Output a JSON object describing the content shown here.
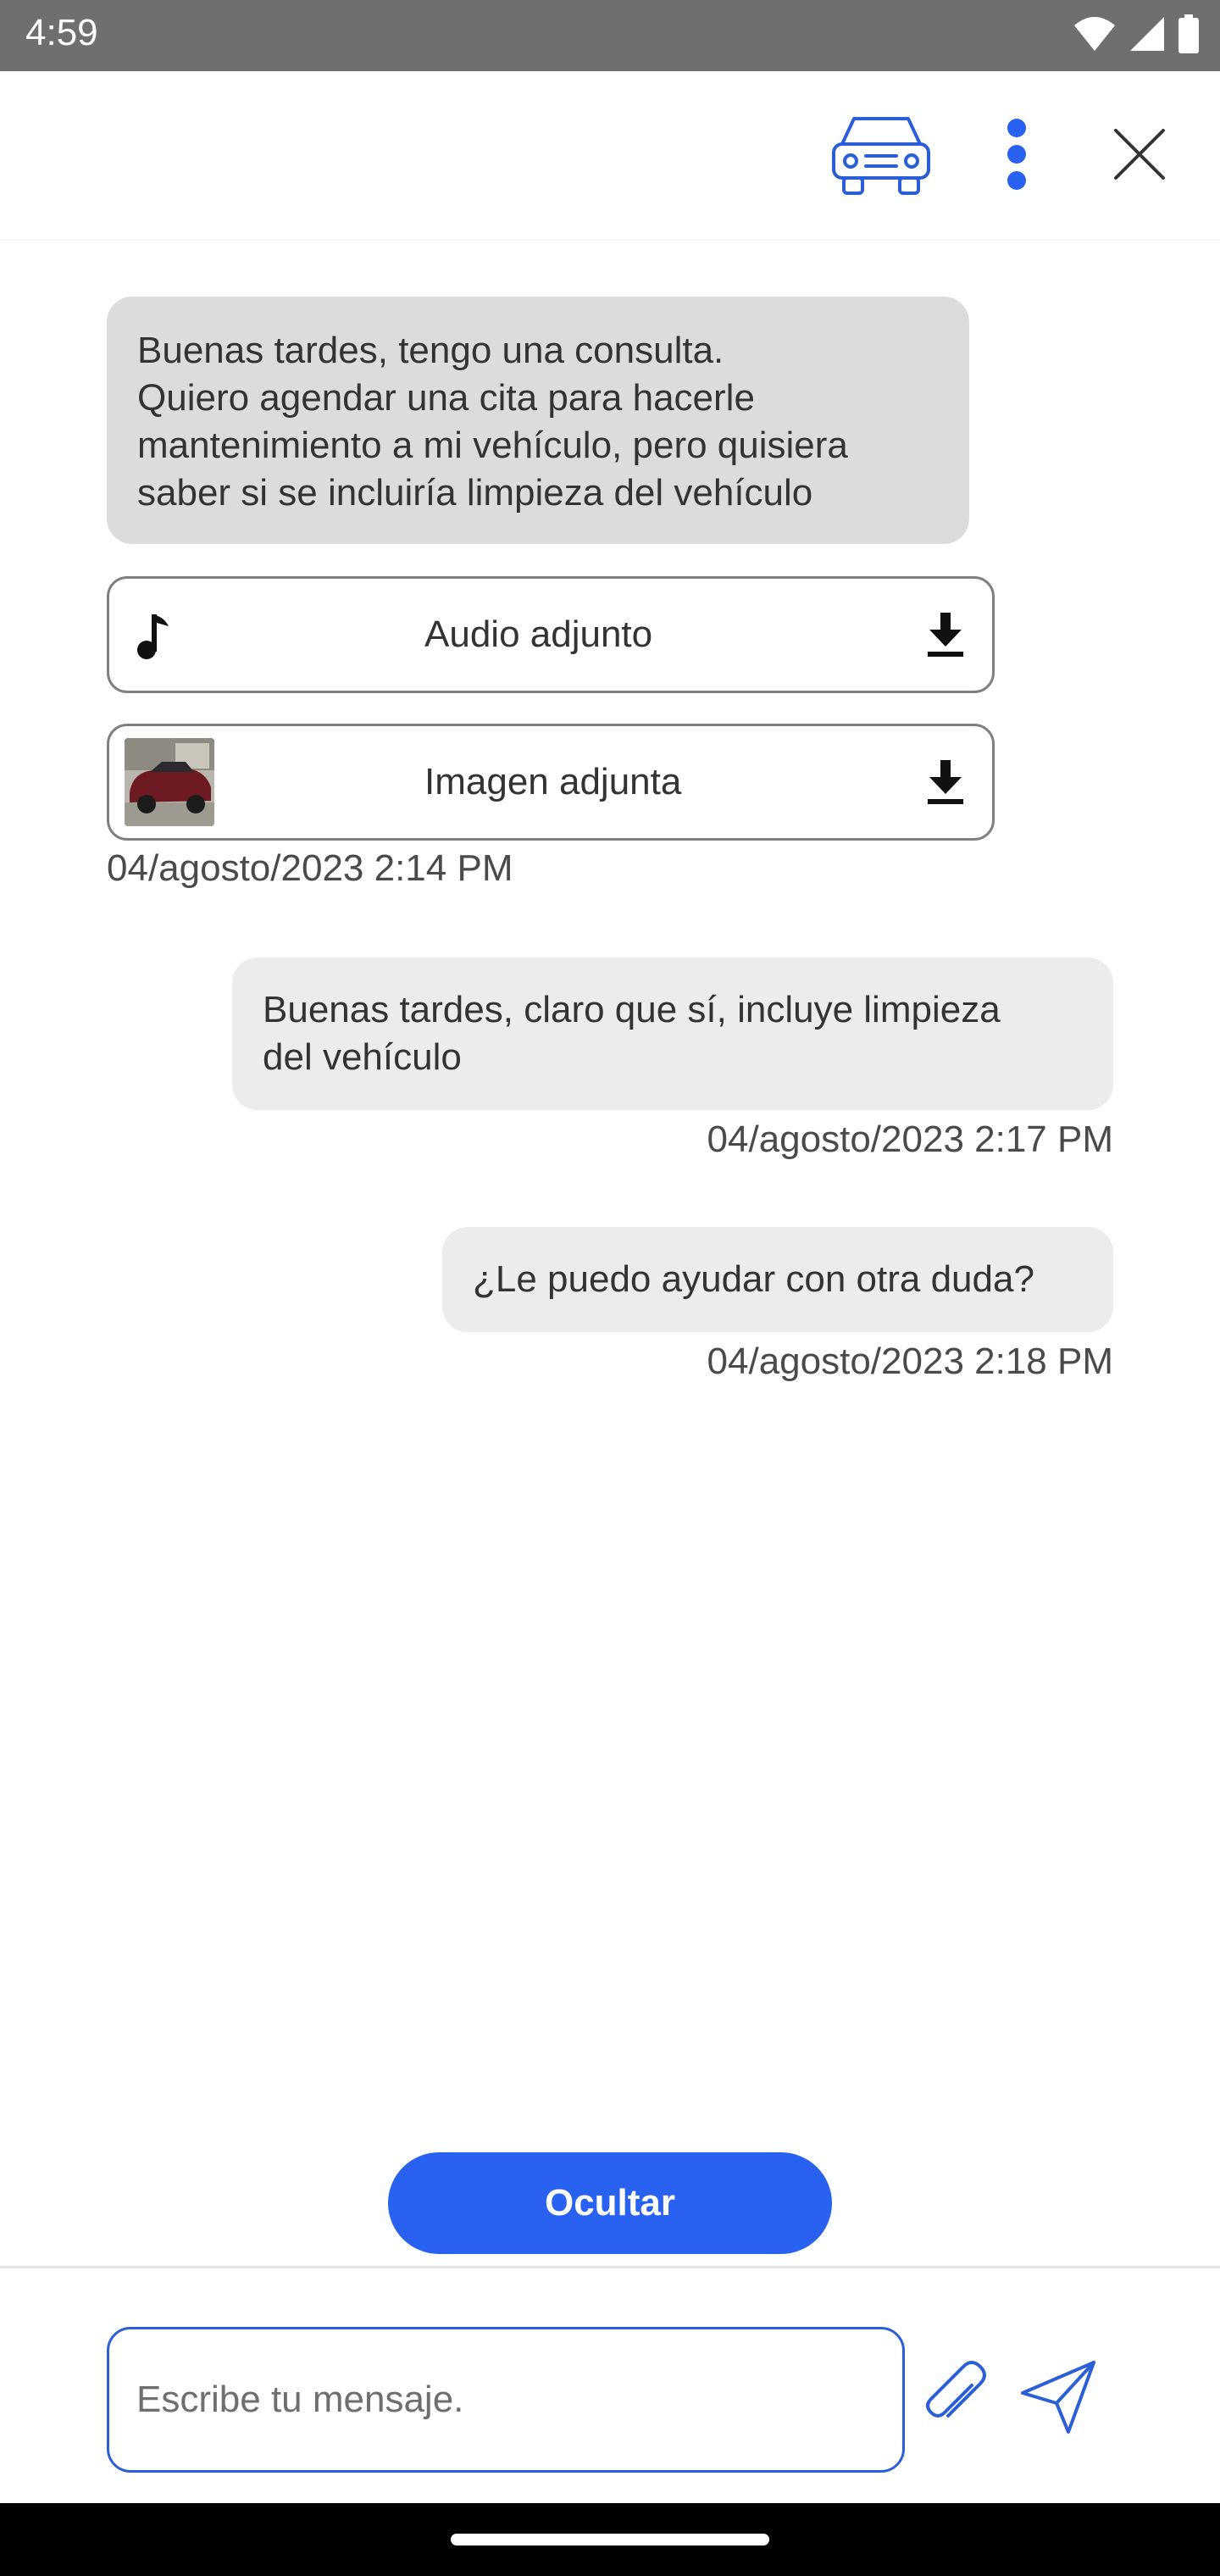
{
  "status_bar": {
    "time": "4:59",
    "icons": [
      "wifi-icon",
      "cellular-signal-icon",
      "battery-icon"
    ]
  },
  "header": {
    "icons": [
      "car-icon",
      "more-options-icon",
      "close-icon"
    ]
  },
  "chat": {
    "messages": [
      {
        "direction": "incoming",
        "lines": [
          "Buenas tardes, tengo una consulta.",
          "Quiero agendar una cita para hacerle",
          "mantenimiento a mi vehículo, pero quisiera",
          "saber si se incluiría limpieza del vehículo"
        ]
      },
      {
        "direction": "outgoing",
        "lines": [
          "Buenas tardes, claro que sí, incluye limpieza",
          "del vehículo"
        ],
        "timestamp": "04/agosto/2023 2:17 PM"
      },
      {
        "direction": "outgoing",
        "lines": [
          "¿Le puedo ayudar con otra duda?"
        ],
        "timestamp": "04/agosto/2023 2:18 PM"
      }
    ],
    "attachments": {
      "audio_label": "Audio adjunto",
      "image_label": "Imagen adjunta",
      "timestamp": "04/agosto/2023 2:14 PM"
    }
  },
  "hide_button": {
    "label": "Ocultar"
  },
  "composer": {
    "placeholder": "Escribe tu mensaje.",
    "value": ""
  },
  "colors": {
    "accent": "#2961f0",
    "status_bar": "#6f6f6f",
    "incoming_bubble": "#dcdcdc",
    "outgoing_bubble": "#ececec"
  }
}
